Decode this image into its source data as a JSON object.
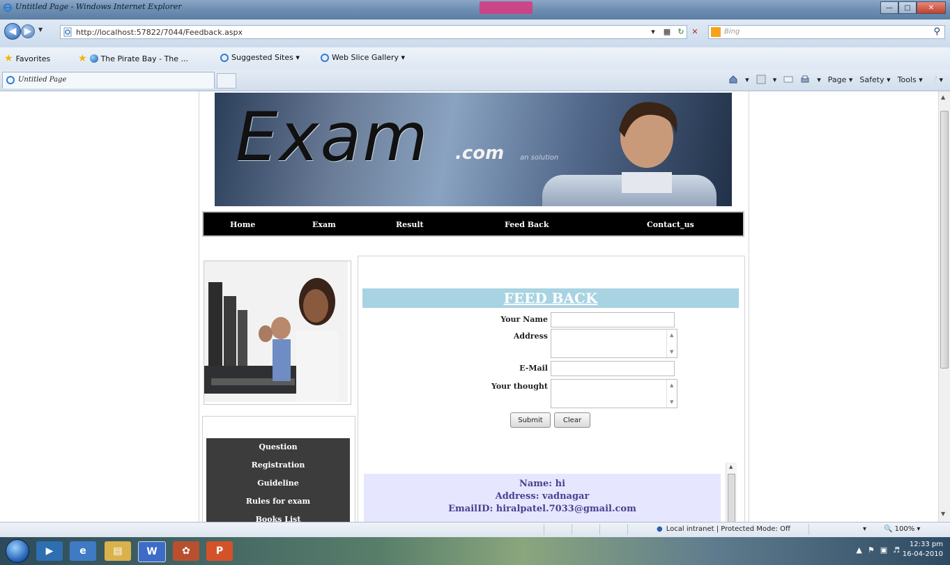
{
  "window": {
    "title": "Untitled Page - Windows Internet Explorer"
  },
  "addressbar": {
    "url": "http://localhost:57822/7044/Feedback.aspx",
    "search_placeholder": "Bing"
  },
  "favorites": {
    "favorites_label": "Favorites",
    "items": [
      "The Pirate Bay - The ...",
      "Suggested Sites ▾",
      "Web Slice Gallery ▾"
    ]
  },
  "tabs": {
    "active_tab": "Untitled Page"
  },
  "commandbar": {
    "page": "Page ▾",
    "safety": "Safety ▾",
    "tools": "Tools ▾",
    "help": "▾"
  },
  "site": {
    "logo": "Exam",
    "logo_suffix": ".com",
    "tagline": "an solution",
    "nav": [
      "Home",
      "Exam",
      "Result",
      "Feed Back",
      "Contact_us"
    ],
    "side_menu": [
      "Question",
      "Registration",
      "Guideline",
      "Rules for exam",
      "Books List"
    ]
  },
  "feedback": {
    "heading": "FEED BACK",
    "labels": {
      "name": "Your Name",
      "address": "Address",
      "email": "E-Mail",
      "thought": "Your thought"
    },
    "values": {
      "name": "",
      "address": "",
      "email": "",
      "thought": ""
    },
    "submit_label": "Submit",
    "clear_label": "Clear"
  },
  "results": {
    "name_line": "Name: hi",
    "address_line": "Address: vadnagar",
    "email_line": "EmailID: hiralpatel.7033@gmail.com"
  },
  "status": {
    "zone": "Local intranet | Protected Mode: Off",
    "zoom": "100%"
  },
  "taskbar": {
    "time": "12:33 pm",
    "date": "16-04-2010"
  }
}
